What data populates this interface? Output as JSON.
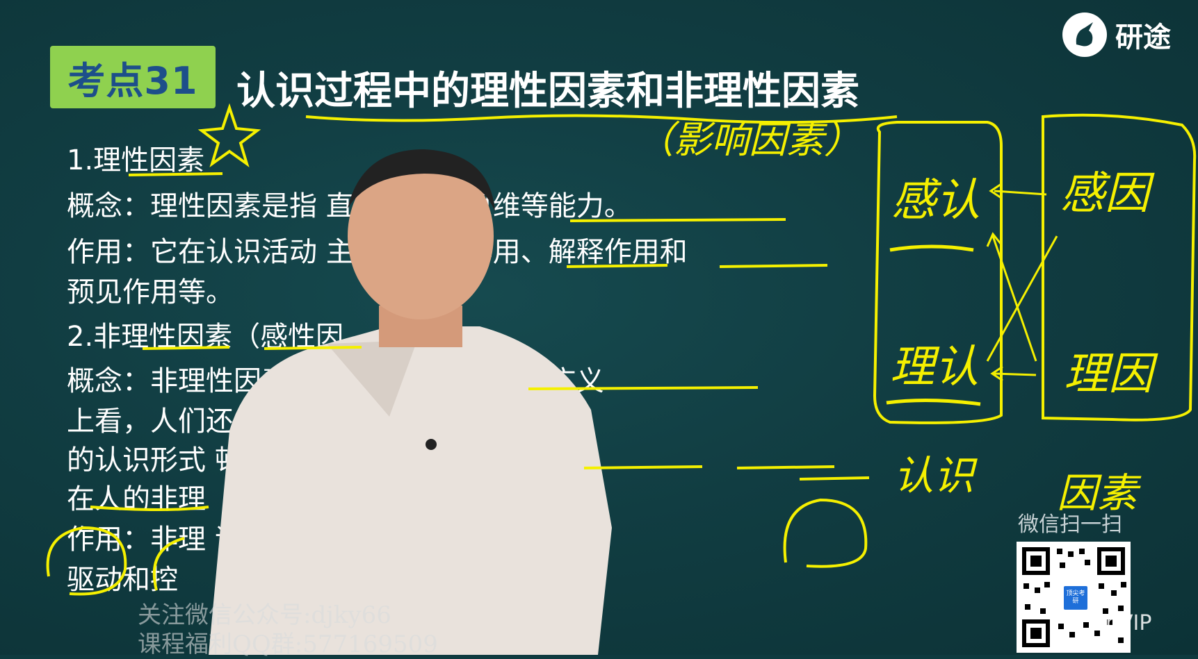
{
  "slide": {
    "badge": "考点31",
    "title": "认识过程中的理性因素和非理性因素",
    "lines": [
      "1.理性因素",
      "概念：理性因素是指          直观、理性思维等能力。",
      "作用：它在认识活动         主要有指导作用、解释作用和",
      "预见作用等。",
      "2.非理性因素（感性因",
      "概念：非理性因素              体的情感和意志。从广义",
      "上看，人们还               自觉、非逻辑性等特点",
      "的认识形式                  顿悟、灵感等，也包括",
      "在人的非理",
      "作用：非理                  识活动具有激活、",
      "驱动和控"
    ]
  },
  "handwriting": {
    "title_note": "（影响因素）",
    "box_left_top": "感认",
    "box_left_bottom": "理认",
    "box_right_top": "感因",
    "box_right_bottom": "理因",
    "label_left": "认识",
    "label_right": "因素"
  },
  "brand": {
    "logo_text": "研途"
  },
  "qr": {
    "label": "微信扫一扫",
    "center_text": "顶尖考研",
    "vip_text": "nVIP"
  },
  "watermarks": {
    "line1": "关注微信公众号:djky66",
    "line2": "课程福利QQ群:577169509"
  },
  "colors": {
    "board": "#113d42",
    "badge": "#8fd14f",
    "badge_text": "#1d4f8a",
    "ink": "#f5f000"
  }
}
